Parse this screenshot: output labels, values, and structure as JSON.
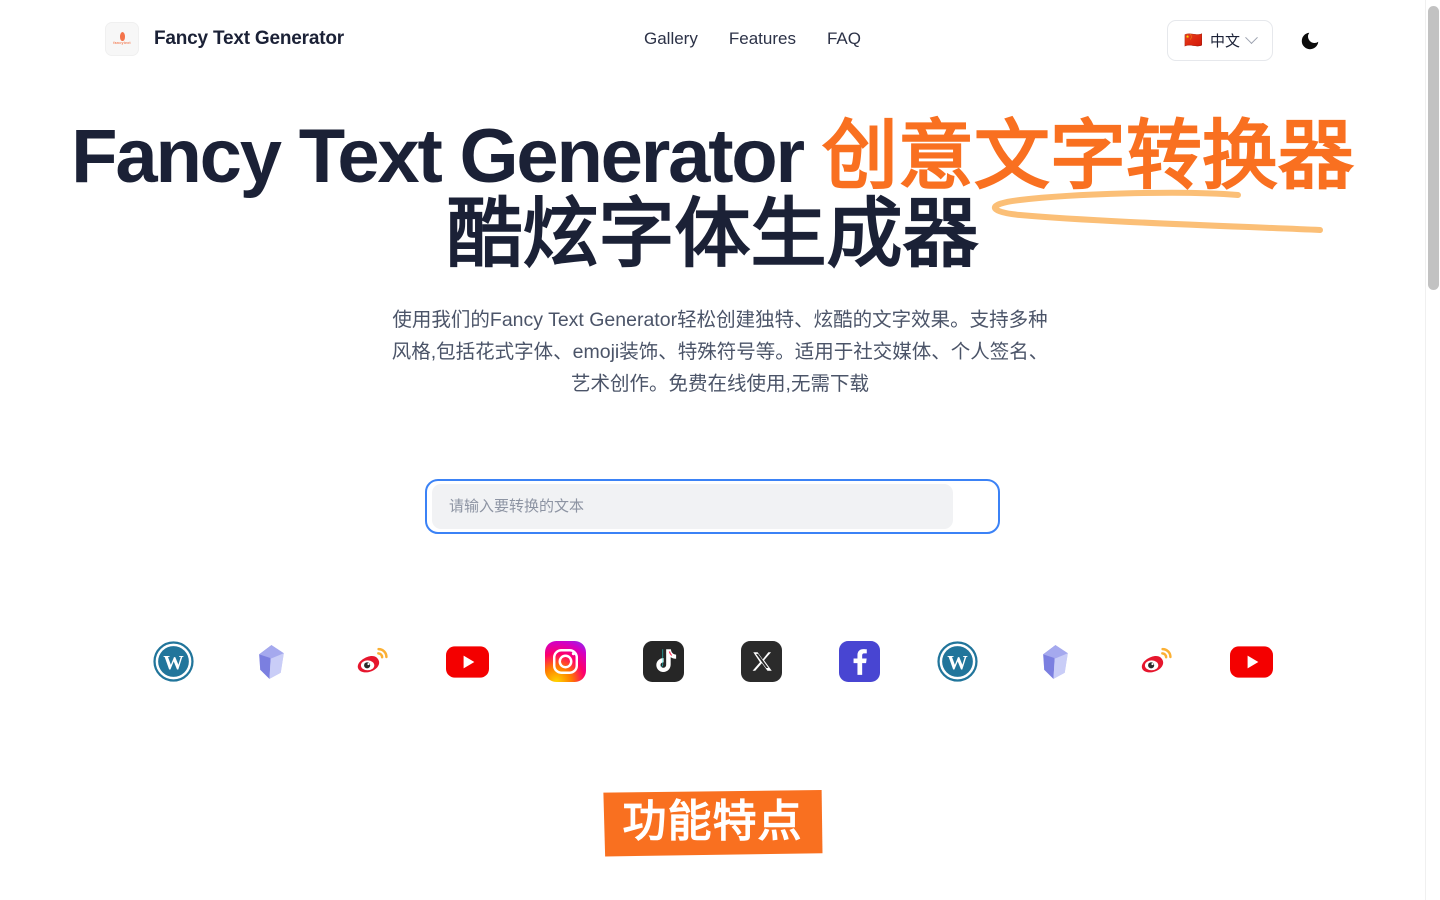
{
  "header": {
    "brand_name": "Fancy Text Generator",
    "logo_wordmark": "fancytext",
    "nav": [
      {
        "label": "Gallery",
        "name": "nav-gallery"
      },
      {
        "label": "Features",
        "name": "nav-features"
      },
      {
        "label": "FAQ",
        "name": "nav-faq"
      }
    ],
    "language": {
      "flag": "🇨🇳",
      "label": "中文",
      "chevron": "chevron-down-icon"
    },
    "theme_toggle": {
      "icon": "moon-icon",
      "glyph": "🌙"
    }
  },
  "hero": {
    "title_en": "Fancy Text Generator ",
    "title_zh_accent": "创意文字转换器",
    "title_zh_line2": "酷炫字体生成器",
    "description": "使用我们的Fancy Text Generator轻松创建独特、炫酷的文字效果。支持多种风格,包括花式字体、emoji装饰、特殊符号等。适用于社交媒体、个人签名、艺术创作。免费在线使用,无需下载"
  },
  "search": {
    "placeholder": "请输入要转换的文本",
    "value": ""
  },
  "social_icons": [
    {
      "name": "wordpress-icon",
      "label": "WordPress"
    },
    {
      "name": "sketch-icon",
      "label": "Sketch"
    },
    {
      "name": "weibo-icon",
      "label": "Weibo"
    },
    {
      "name": "youtube-icon",
      "label": "YouTube"
    },
    {
      "name": "instagram-icon",
      "label": "Instagram"
    },
    {
      "name": "tiktok-icon",
      "label": "TikTok"
    },
    {
      "name": "x-icon",
      "label": "X"
    },
    {
      "name": "facebook-icon",
      "label": "Facebook"
    },
    {
      "name": "wordpress-icon",
      "label": "WordPress"
    },
    {
      "name": "sketch-icon",
      "label": "Sketch"
    },
    {
      "name": "weibo-icon",
      "label": "Weibo"
    },
    {
      "name": "youtube-icon",
      "label": "YouTube"
    }
  ],
  "features": {
    "heading": "功能特点"
  },
  "colors": {
    "accent_orange": "#f97020",
    "swoosh_orange": "#fbbf77",
    "text_dark": "#1b2136",
    "text_muted": "#4b5468",
    "focus_blue": "#3b82f6",
    "input_bg": "#f1f2f4"
  }
}
